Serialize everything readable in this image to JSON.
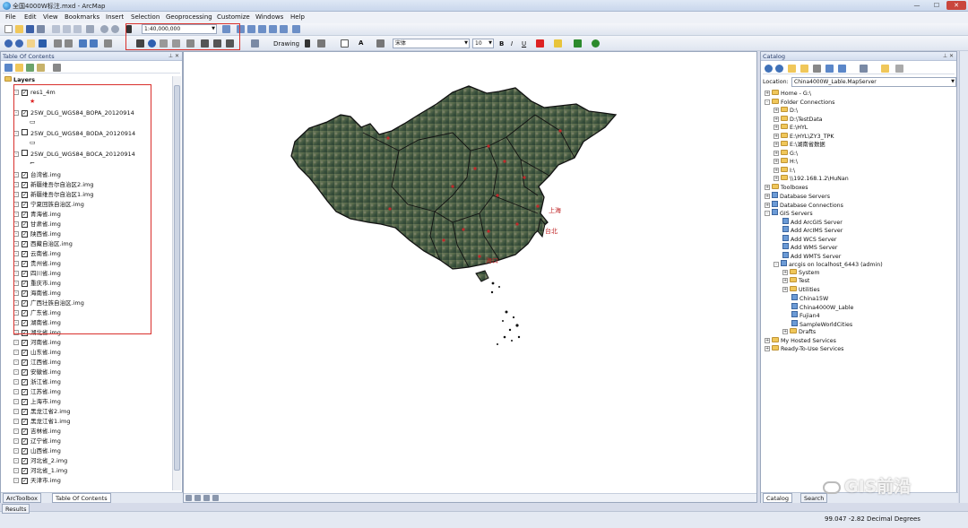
{
  "window": {
    "title": "全国4000W标注.mxd - ArcMap",
    "buttons": [
      "—",
      "☐",
      "✕"
    ]
  },
  "menu": [
    "File",
    "Edit",
    "View",
    "Bookmarks",
    "Insert",
    "Selection",
    "Geoprocessing",
    "Customize",
    "Windows",
    "Help"
  ],
  "toolbar": {
    "scale_value": "1:40,000,000",
    "drawing_label": "Drawing",
    "font_name": "宋体",
    "font_size": "10",
    "bold": "B",
    "italic": "I",
    "underline": "U",
    "text_tool": "A"
  },
  "toc": {
    "title": "Table Of Contents",
    "root": "Layers",
    "layers": [
      {
        "name": "res1_4m",
        "checked": true,
        "symbol": "★"
      },
      {
        "name": "25W_DLG_WGS84_BOPA_20120914",
        "checked": true,
        "symbol": "▭"
      },
      {
        "name": "25W_DLG_WGS84_BODA_20120914",
        "checked": false,
        "symbol": "▭"
      },
      {
        "name": "25W_DLG_WGS84_BOCA_20120914",
        "checked": false,
        "symbol": "⌐"
      },
      {
        "name": "台湾省.img",
        "checked": true
      },
      {
        "name": "新疆维吾尔自治区2.img",
        "checked": true
      },
      {
        "name": "新疆维吾尔自治区1.img",
        "checked": true
      },
      {
        "name": "宁夏回族自治区.img",
        "checked": true
      },
      {
        "name": "青海省.img",
        "checked": true
      },
      {
        "name": "甘肃省.img",
        "checked": true
      },
      {
        "name": "陕西省.img",
        "checked": true
      },
      {
        "name": "西藏自治区.img",
        "checked": true
      },
      {
        "name": "云南省.img",
        "checked": true
      },
      {
        "name": "贵州省.img",
        "checked": true
      },
      {
        "name": "四川省.img",
        "checked": true
      },
      {
        "name": "重庆市.img",
        "checked": true
      },
      {
        "name": "海南省.img",
        "checked": true
      },
      {
        "name": "广西壮族自治区.img",
        "checked": true
      },
      {
        "name": "广东省.img",
        "checked": true
      },
      {
        "name": "湖南省.img",
        "checked": true
      },
      {
        "name": "湖北省.img",
        "checked": true
      },
      {
        "name": "河南省.img",
        "checked": true
      },
      {
        "name": "山东省.img",
        "checked": true
      },
      {
        "name": "江西省.img",
        "checked": true
      },
      {
        "name": "安徽省.img",
        "checked": true
      },
      {
        "name": "浙江省.img",
        "checked": true
      },
      {
        "name": "江苏省.img",
        "checked": true
      },
      {
        "name": "上海市.img",
        "checked": true
      },
      {
        "name": "黑龙江省2.img",
        "checked": true
      },
      {
        "name": "黑龙江省1.img",
        "checked": true
      },
      {
        "name": "吉林省.img",
        "checked": true
      },
      {
        "name": "辽宁省.img",
        "checked": true
      },
      {
        "name": "山西省.img",
        "checked": true
      },
      {
        "name": "河北省_2.img",
        "checked": true
      },
      {
        "name": "河北省_1.img",
        "checked": true
      },
      {
        "name": "天津市.img",
        "checked": true
      }
    ],
    "tabs": [
      "ArcToolbox",
      "Table Of Contents"
    ],
    "results_label": "Results"
  },
  "map": {
    "labels": [
      "台北",
      "上海",
      "海口"
    ]
  },
  "catalog": {
    "title": "Catalog",
    "location_label": "Location:",
    "location_value": "China4000W_Lable.MapServer",
    "tree": [
      {
        "label": "Home - G:\\",
        "level": 0,
        "type": "folder",
        "exp": "+"
      },
      {
        "label": "Folder Connections",
        "level": 0,
        "type": "folder",
        "exp": "-"
      },
      {
        "label": "D:\\",
        "level": 1,
        "type": "folder",
        "exp": "+"
      },
      {
        "label": "D:\\TestData",
        "level": 1,
        "type": "folder",
        "exp": "+"
      },
      {
        "label": "E:\\HYL",
        "level": 1,
        "type": "folder",
        "exp": "+"
      },
      {
        "label": "E:\\HYL\\ZY3_TPK",
        "level": 1,
        "type": "folder",
        "exp": "+"
      },
      {
        "label": "E:\\湖南省数据",
        "level": 1,
        "type": "folder",
        "exp": "+"
      },
      {
        "label": "G:\\",
        "level": 1,
        "type": "folder",
        "exp": "+"
      },
      {
        "label": "H:\\",
        "level": 1,
        "type": "folder",
        "exp": "+"
      },
      {
        "label": "I:\\",
        "level": 1,
        "type": "folder",
        "exp": "+"
      },
      {
        "label": "\\\\192.168.1.2\\HuNan",
        "level": 1,
        "type": "folder",
        "exp": "+"
      },
      {
        "label": "Toolboxes",
        "level": 0,
        "type": "folder",
        "exp": "+"
      },
      {
        "label": "Database Servers",
        "level": 0,
        "type": "srv",
        "exp": "+"
      },
      {
        "label": "Database Connections",
        "level": 0,
        "type": "srv",
        "exp": "+"
      },
      {
        "label": "GIS Servers",
        "level": 0,
        "type": "srv",
        "exp": "-"
      },
      {
        "label": "Add ArcGIS Server",
        "level": 1,
        "type": "srv",
        "exp": ""
      },
      {
        "label": "Add ArcIMS Server",
        "level": 1,
        "type": "srv",
        "exp": ""
      },
      {
        "label": "Add WCS Server",
        "level": 1,
        "type": "srv",
        "exp": ""
      },
      {
        "label": "Add WMS Server",
        "level": 1,
        "type": "srv",
        "exp": ""
      },
      {
        "label": "Add WMTS Server",
        "level": 1,
        "type": "srv",
        "exp": ""
      },
      {
        "label": "arcgis on localhost_6443 (admin)",
        "level": 1,
        "type": "srv",
        "exp": "-"
      },
      {
        "label": "System",
        "level": 2,
        "type": "folder",
        "exp": "+"
      },
      {
        "label": "Test",
        "level": 2,
        "type": "folder",
        "exp": "+"
      },
      {
        "label": "Utilities",
        "level": 2,
        "type": "folder",
        "exp": "+"
      },
      {
        "label": "China15W",
        "level": 2,
        "type": "srv",
        "exp": ""
      },
      {
        "label": "China4000W_Lable",
        "level": 2,
        "type": "srv",
        "exp": ""
      },
      {
        "label": "Fujian4",
        "level": 2,
        "type": "srv",
        "exp": ""
      },
      {
        "label": "SampleWorldCities",
        "level": 2,
        "type": "srv",
        "exp": ""
      },
      {
        "label": "Drafts",
        "level": 2,
        "type": "folder",
        "exp": "+"
      },
      {
        "label": "My Hosted Services",
        "level": 0,
        "type": "folder",
        "exp": "+"
      },
      {
        "label": "Ready-To-Use Services",
        "level": 0,
        "type": "folder",
        "exp": "+"
      }
    ],
    "tabs": [
      "Catalog",
      "Search"
    ]
  },
  "status": {
    "coords": "99.047 -2.82 Decimal Degrees"
  },
  "watermark": "GIS前沿",
  "colors": {
    "highlight_box": "#d9302c",
    "map_label": "#c0282a"
  }
}
